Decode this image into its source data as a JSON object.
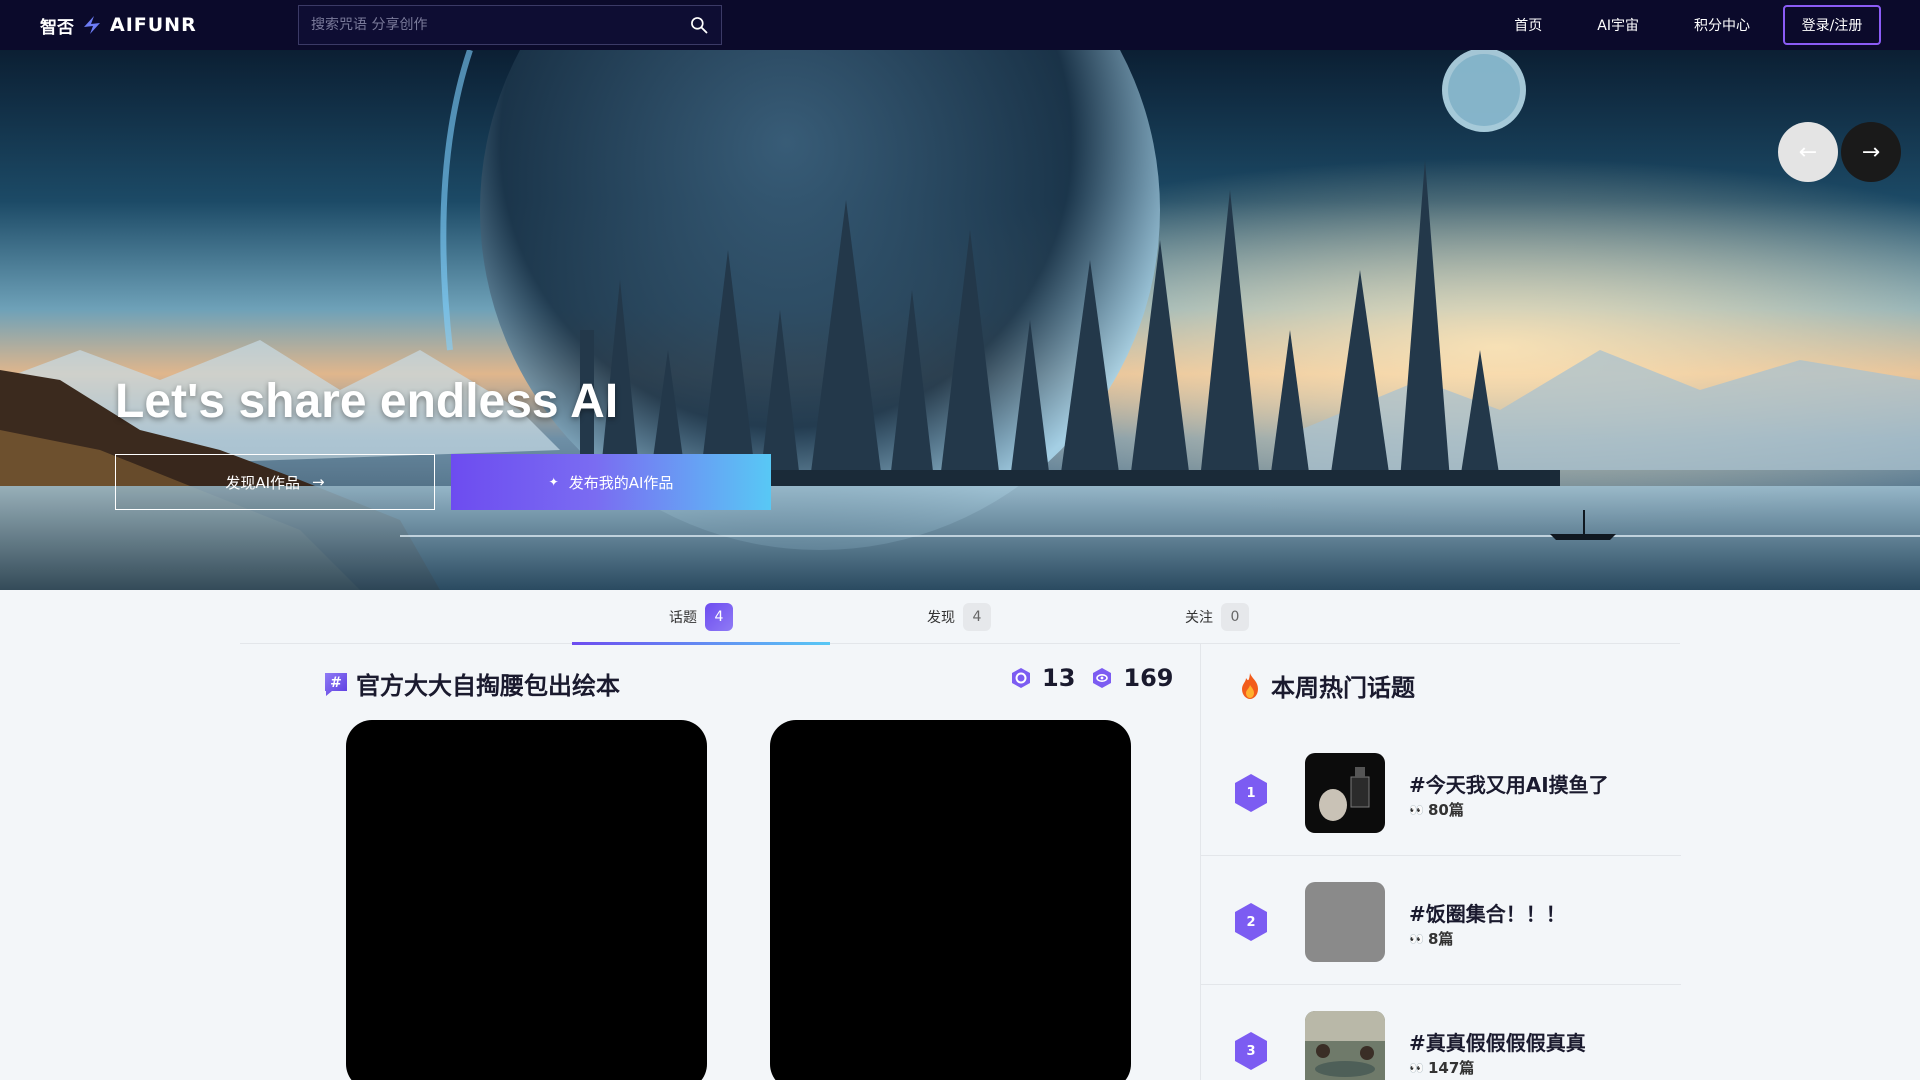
{
  "nav": {
    "logo_cn": "智否",
    "logo_en": "AIFUNR",
    "search_placeholder": "搜索咒语 分享创作",
    "links": [
      "首页",
      "AI宇宙",
      "积分中心"
    ],
    "login_label": "登录/注册"
  },
  "hero": {
    "title": "Let's share endless AI",
    "discover_label": "发现AI作品",
    "publish_label": "发布我的AI作品"
  },
  "tabs": [
    {
      "label": "话题",
      "count": "4",
      "active": true
    },
    {
      "label": "发现",
      "count": "4",
      "active": false
    },
    {
      "label": "关注",
      "count": "0",
      "active": false
    }
  ],
  "topic": {
    "title": "官方大大自掏腰包出绘本",
    "stat_works": "13",
    "stat_views": "169"
  },
  "hot": {
    "title": "本周热门话题",
    "items": [
      {
        "rank": "1",
        "name": "#今天我又用AI摸鱼了",
        "count": "80篇"
      },
      {
        "rank": "2",
        "name": "#饭圈集合！！！",
        "count": "8篇"
      },
      {
        "rank": "3",
        "name": "#真真假假假假真真",
        "count": "147篇"
      }
    ]
  },
  "colors": {
    "accent": "#6d4cf0",
    "accent_light": "#58c8f5",
    "nav_bg": "#0b0a2b"
  }
}
